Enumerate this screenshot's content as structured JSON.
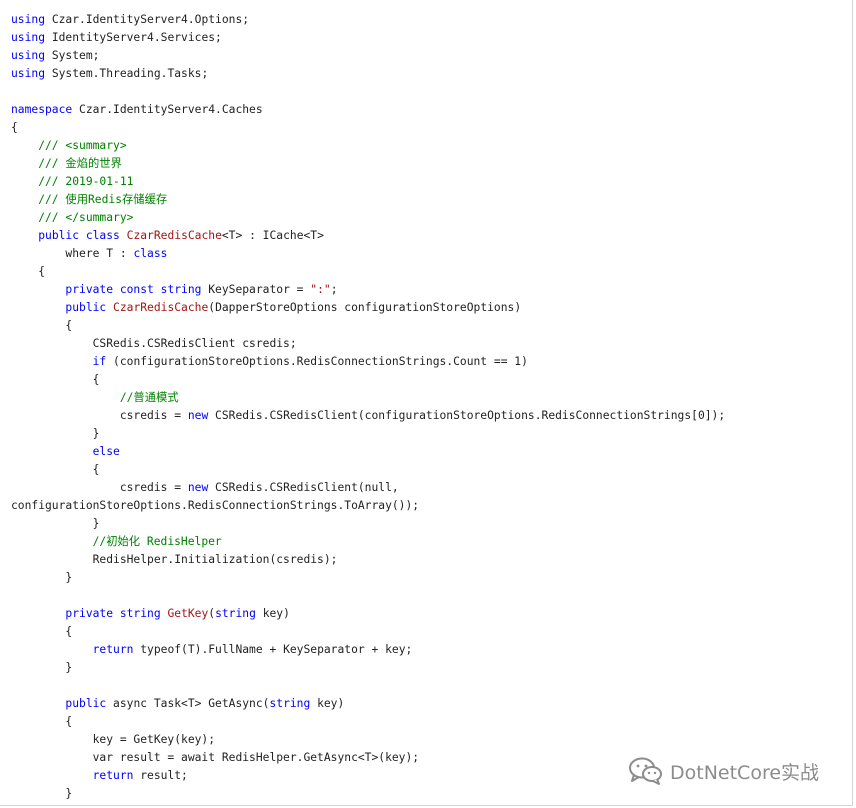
{
  "code_lines": [
    [
      {
        "text": "using",
        "cls": "k"
      },
      {
        "text": " Czar.IdentityServer4.Options;",
        "cls": "p"
      }
    ],
    [
      {
        "text": "using",
        "cls": "k"
      },
      {
        "text": " IdentityServer4.Services;",
        "cls": "p"
      }
    ],
    [
      {
        "text": "using",
        "cls": "k"
      },
      {
        "text": " System;",
        "cls": "p"
      }
    ],
    [
      {
        "text": "using",
        "cls": "k"
      },
      {
        "text": " System.Threading.Tasks;",
        "cls": "p"
      }
    ],
    [],
    [
      {
        "text": "namespace",
        "cls": "k"
      },
      {
        "text": " Czar.IdentityServer4.Caches",
        "cls": "p"
      }
    ],
    [
      {
        "text": "{",
        "cls": "p"
      }
    ],
    [
      {
        "text": "    /// <summary>",
        "cls": "c"
      }
    ],
    [
      {
        "text": "    /// 金焰的世界",
        "cls": "c"
      }
    ],
    [
      {
        "text": "    /// 2019-01-11",
        "cls": "c"
      }
    ],
    [
      {
        "text": "    /// 使用Redis存储缓存",
        "cls": "c"
      }
    ],
    [
      {
        "text": "    /// </summary>",
        "cls": "c"
      }
    ],
    [
      {
        "text": "    ",
        "cls": "p"
      },
      {
        "text": "public class",
        "cls": "k"
      },
      {
        "text": " ",
        "cls": "p"
      },
      {
        "text": "CzarRedisCache",
        "cls": "t"
      },
      {
        "text": "<T> : ICache<T>",
        "cls": "p"
      }
    ],
    [
      {
        "text": "        where T : ",
        "cls": "p"
      },
      {
        "text": "class",
        "cls": "k"
      }
    ],
    [
      {
        "text": "    {",
        "cls": "p"
      }
    ],
    [
      {
        "text": "        ",
        "cls": "p"
      },
      {
        "text": "private const string",
        "cls": "k"
      },
      {
        "text": " KeySeparator = ",
        "cls": "p"
      },
      {
        "text": "\":\"",
        "cls": "s"
      },
      {
        "text": ";",
        "cls": "p"
      }
    ],
    [
      {
        "text": "        ",
        "cls": "p"
      },
      {
        "text": "public",
        "cls": "k"
      },
      {
        "text": " ",
        "cls": "p"
      },
      {
        "text": "CzarRedisCache",
        "cls": "t"
      },
      {
        "text": "(DapperStoreOptions configurationStoreOptions)",
        "cls": "p"
      }
    ],
    [
      {
        "text": "        {",
        "cls": "p"
      }
    ],
    [
      {
        "text": "            CSRedis.CSRedisClient csredis;",
        "cls": "p"
      }
    ],
    [
      {
        "text": "            ",
        "cls": "p"
      },
      {
        "text": "if",
        "cls": "k"
      },
      {
        "text": " (configurationStoreOptions.RedisConnectionStrings.Count == 1)",
        "cls": "p"
      }
    ],
    [
      {
        "text": "            {",
        "cls": "p"
      }
    ],
    [
      {
        "text": "                //普通模式",
        "cls": "c"
      }
    ],
    [
      {
        "text": "                csredis = ",
        "cls": "p"
      },
      {
        "text": "new",
        "cls": "k"
      },
      {
        "text": " CSRedis.CSRedisClient(configurationStoreOptions.RedisConnectionStrings[0]);",
        "cls": "p"
      }
    ],
    [
      {
        "text": "            }",
        "cls": "p"
      }
    ],
    [
      {
        "text": "            ",
        "cls": "p"
      },
      {
        "text": "else",
        "cls": "k"
      }
    ],
    [
      {
        "text": "            {",
        "cls": "p"
      }
    ],
    [
      {
        "text": "                csredis = ",
        "cls": "p"
      },
      {
        "text": "new",
        "cls": "k"
      },
      {
        "text": " CSRedis.CSRedisClient(null,",
        "cls": "p"
      }
    ],
    [
      {
        "text": "configurationStoreOptions.RedisConnectionStrings.ToArray());",
        "cls": "p"
      }
    ],
    [
      {
        "text": "            }",
        "cls": "p"
      }
    ],
    [
      {
        "text": "            //初始化 RedisHelper",
        "cls": "c"
      }
    ],
    [
      {
        "text": "            RedisHelper.Initialization(csredis);",
        "cls": "p"
      }
    ],
    [
      {
        "text": "        }",
        "cls": "p"
      }
    ],
    [],
    [
      {
        "text": "        ",
        "cls": "p"
      },
      {
        "text": "private string",
        "cls": "k"
      },
      {
        "text": " ",
        "cls": "p"
      },
      {
        "text": "GetKey",
        "cls": "t"
      },
      {
        "text": "(",
        "cls": "p"
      },
      {
        "text": "string",
        "cls": "k"
      },
      {
        "text": " key)",
        "cls": "p"
      }
    ],
    [
      {
        "text": "        {",
        "cls": "p"
      }
    ],
    [
      {
        "text": "            ",
        "cls": "p"
      },
      {
        "text": "return",
        "cls": "k"
      },
      {
        "text": " typeof(T).FullName + KeySeparator + key;",
        "cls": "p"
      }
    ],
    [
      {
        "text": "        }",
        "cls": "p"
      }
    ],
    [],
    [
      {
        "text": "        ",
        "cls": "p"
      },
      {
        "text": "public",
        "cls": "k"
      },
      {
        "text": " async Task<T> GetAsync(",
        "cls": "p"
      },
      {
        "text": "string",
        "cls": "k"
      },
      {
        "text": " key)",
        "cls": "p"
      }
    ],
    [
      {
        "text": "        {",
        "cls": "p"
      }
    ],
    [
      {
        "text": "            key = GetKey(key);",
        "cls": "p"
      }
    ],
    [
      {
        "text": "            var result = await RedisHelper.GetAsync<T>(key);",
        "cls": "p"
      }
    ],
    [
      {
        "text": "            ",
        "cls": "p"
      },
      {
        "text": "return",
        "cls": "k"
      },
      {
        "text": " result;",
        "cls": "p"
      }
    ],
    [
      {
        "text": "        }",
        "cls": "p"
      }
    ]
  ],
  "watermark": {
    "icon": "wechat-bubbles-icon",
    "text": "DotNetCore实战"
  },
  "colors": {
    "keyword": "#0000ff",
    "comment": "#008000",
    "type_name": "#a31515",
    "plain": "#222222",
    "watermark": "#8c8c8c"
  }
}
